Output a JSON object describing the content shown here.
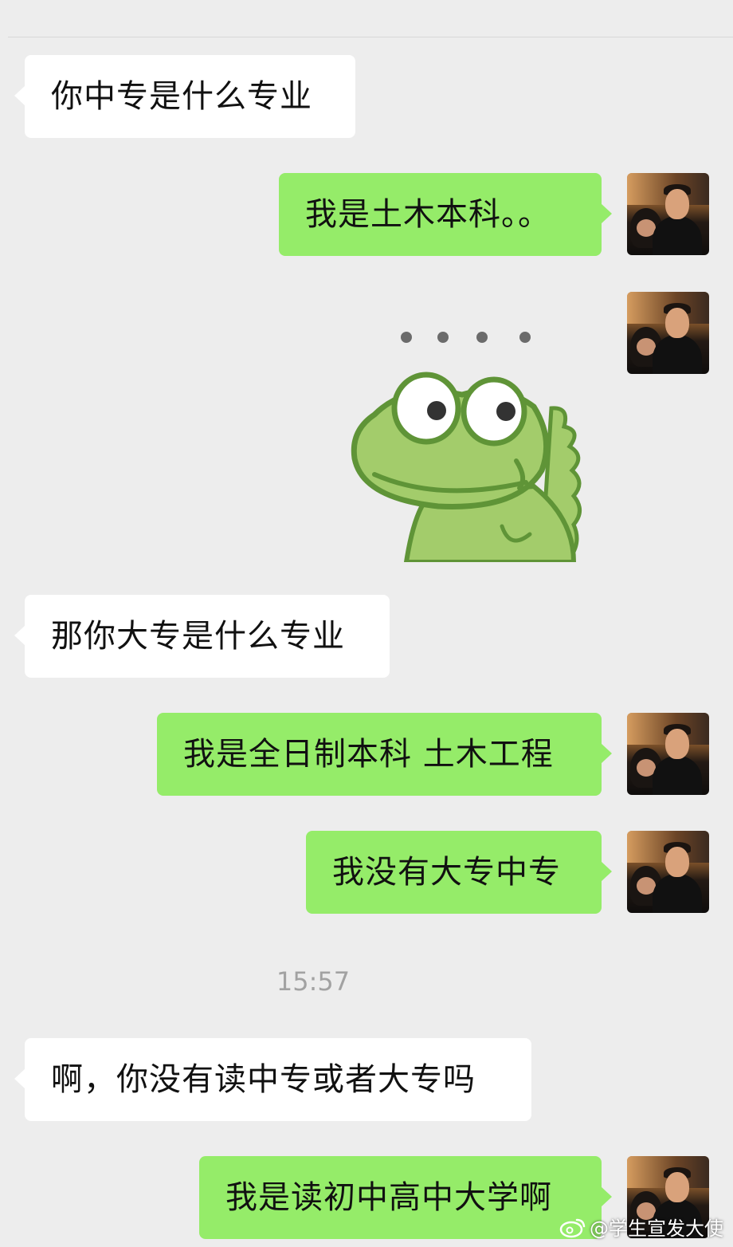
{
  "messages": [
    {
      "side": "in",
      "type": "text",
      "text": "你中专是什么专业"
    },
    {
      "side": "out",
      "type": "text",
      "text": "我是土木本科。。"
    },
    {
      "side": "out",
      "type": "sticker",
      "sticker": "dots-frog-sticker"
    },
    {
      "side": "in",
      "type": "text",
      "text": "那你大专是什么专业"
    },
    {
      "side": "out",
      "type": "text",
      "text": "我是全日制本科 土木工程"
    },
    {
      "side": "out",
      "type": "text",
      "text": "我没有大专中专"
    },
    {
      "side": "in",
      "type": "text",
      "text": "啊，你没有读中专或者大专吗"
    },
    {
      "side": "out",
      "type": "text",
      "text": "我是读初中高中大学啊"
    }
  ],
  "timestamp": "15:57",
  "watermark": {
    "text": "@学生宣发大使",
    "icon": "weibo-icon"
  },
  "colors": {
    "background": "#ededed",
    "incoming": "#ffffff",
    "outgoing": "#95ec69",
    "timestamp": "#a2a2a2"
  }
}
